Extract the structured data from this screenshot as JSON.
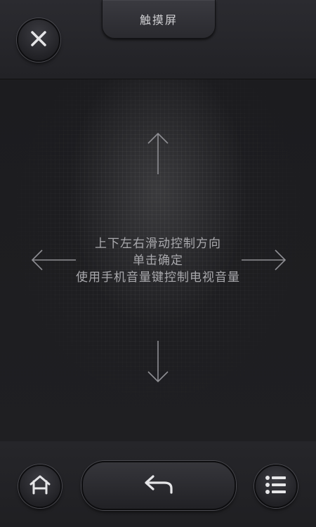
{
  "header": {
    "title": "触摸屏",
    "close_icon": "close-icon"
  },
  "touchpad": {
    "instructions": [
      "上下左右滑动控制方向",
      "单击确定",
      "使用手机音量键控制电视音量"
    ],
    "arrows": [
      "arrow-up-icon",
      "arrow-down-icon",
      "arrow-left-icon",
      "arrow-right-icon"
    ]
  },
  "footer": {
    "home_icon": "home-icon",
    "back_icon": "back-icon",
    "menu_icon": "menu-list-icon"
  },
  "colors": {
    "background": "#26262a",
    "touchpad": "#1e1e21",
    "text": "#a9a9ad",
    "icon": "#e6e6e8"
  }
}
